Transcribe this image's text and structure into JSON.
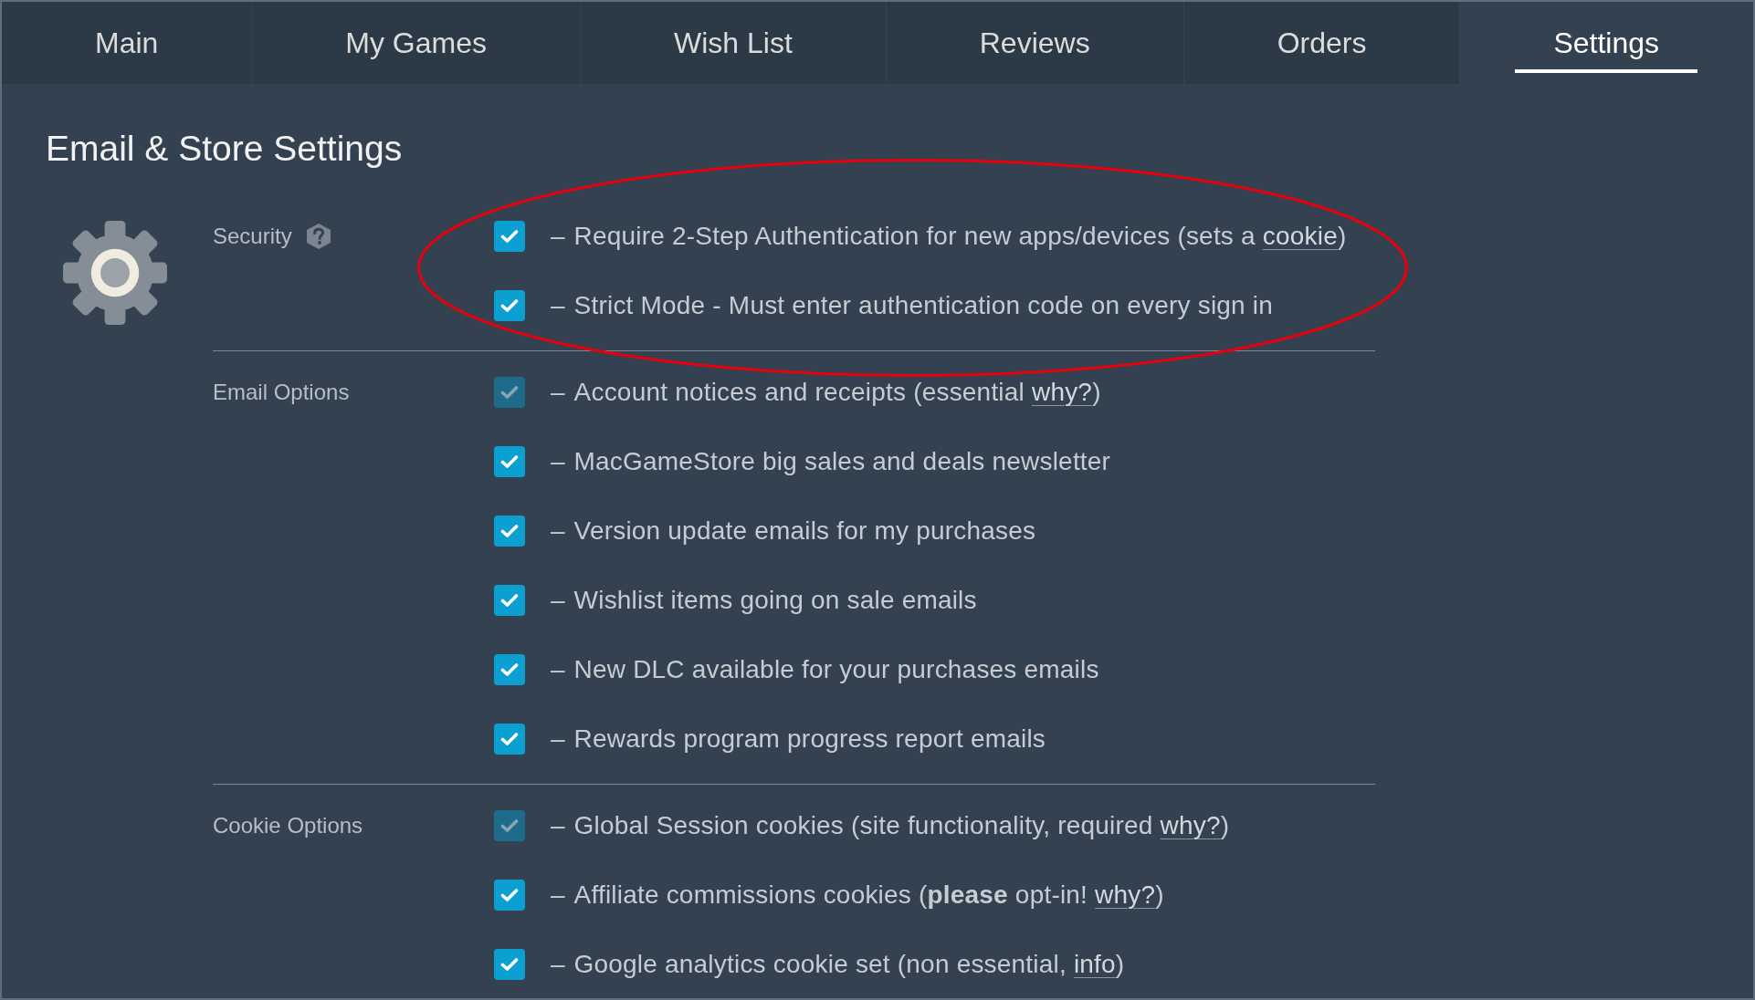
{
  "tabs": [
    {
      "label": "Main",
      "selected": false
    },
    {
      "label": "My Games",
      "selected": false
    },
    {
      "label": "Wish List",
      "selected": false
    },
    {
      "label": "Reviews",
      "selected": false
    },
    {
      "label": "Orders",
      "selected": false
    },
    {
      "label": "Settings",
      "selected": true
    }
  ],
  "page_title": "Email & Store Settings",
  "sections": [
    {
      "label": "Security",
      "help_icon": true,
      "circled": true,
      "options": [
        {
          "dash": "–",
          "text": "Require 2-Step Authentication for new apps/devices (sets a ",
          "link": "cookie",
          "text_after": ")",
          "checked": true,
          "disabled": false
        },
        {
          "dash": "–",
          "text": "Strict Mode - Must enter authentication code on every sign in",
          "checked": true,
          "disabled": false
        }
      ]
    },
    {
      "label": "Email Options",
      "help_icon": false,
      "circled": false,
      "options": [
        {
          "dash": "–",
          "text": "Account notices and receipts (essential ",
          "link": "why?",
          "text_after": ")",
          "checked": true,
          "disabled": true
        },
        {
          "dash": "–",
          "text": "MacGameStore big sales and deals newsletter",
          "checked": true,
          "disabled": false
        },
        {
          "dash": "–",
          "text": "Version update emails for my purchases",
          "checked": true,
          "disabled": false
        },
        {
          "dash": "–",
          "text": "Wishlist items going on sale emails",
          "checked": true,
          "disabled": false
        },
        {
          "dash": "–",
          "text": "New DLC available for your purchases emails",
          "checked": true,
          "disabled": false
        },
        {
          "dash": "–",
          "text": "Rewards program progress report emails",
          "checked": true,
          "disabled": false
        }
      ]
    },
    {
      "label": "Cookie Options",
      "help_icon": false,
      "circled": false,
      "options": [
        {
          "dash": "–",
          "text": "Global Session cookies (site functionality, required ",
          "link": "why?",
          "text_after": ")",
          "checked": true,
          "disabled": true
        },
        {
          "dash": "–",
          "text": "Affiliate commissions cookies (**please** opt-in! ",
          "link": "why?",
          "text_after": ")",
          "checked": true,
          "disabled": false
        },
        {
          "dash": "–",
          "text": "Google analytics cookie set (non essential, ",
          "link": "info",
          "text_after": ")",
          "checked": true,
          "disabled": false
        }
      ]
    }
  ]
}
